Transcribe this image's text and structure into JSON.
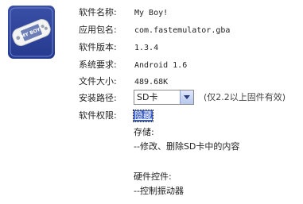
{
  "icon": {
    "name": "gba-console-icon",
    "logo_text": "MY BOY!"
  },
  "fields": [
    {
      "label": "软件名称:",
      "value": "My Boy!"
    },
    {
      "label": "应用包名:",
      "value": "com.fastemulator.gba"
    },
    {
      "label": "软件版本:",
      "value": "1.3.4"
    },
    {
      "label": "系统要求:",
      "value": "Android 1.6"
    },
    {
      "label": "文件大小:",
      "value": "489.68K"
    }
  ],
  "install_path": {
    "label": "安装路径:",
    "selected": "SD卡",
    "note": "(仅2.2以上固件有效)"
  },
  "permissions": {
    "label": "软件权限:",
    "toggle": "隐藏",
    "groups": [
      {
        "title": "存储:",
        "item": "--修改、删除SD卡中的内容"
      },
      {
        "title": "硬件控件:",
        "item": "--控制振动器"
      }
    ]
  }
}
